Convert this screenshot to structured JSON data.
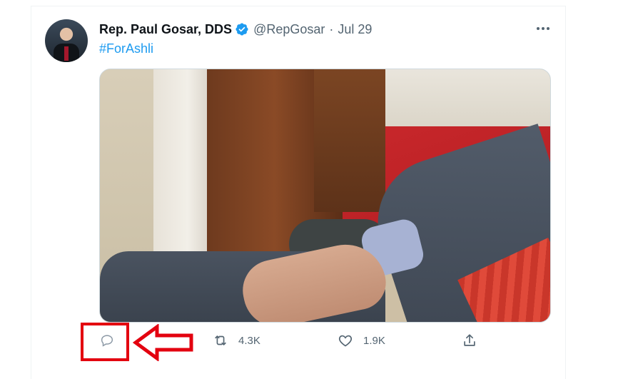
{
  "tweet": {
    "author_name": "Rep. Paul Gosar, DDS",
    "handle": "@RepGosar",
    "separator": "·",
    "date": "Jul 29",
    "text": "#ForAshli",
    "more_icon": "more-horizontal-icon",
    "verified_icon": "verified-badge-icon",
    "colors": {
      "link": "#1d9bf0",
      "muted": "#536471",
      "annotation": "#e3000f"
    }
  },
  "actions": {
    "reply": {
      "icon": "reply-icon",
      "count": ""
    },
    "retweet": {
      "icon": "retweet-icon",
      "count": "4.3K"
    },
    "like": {
      "icon": "like-icon",
      "count": "1.9K"
    },
    "share": {
      "icon": "share-icon"
    }
  },
  "annotation": {
    "type": "red box with arrow pointing at reply icon"
  }
}
